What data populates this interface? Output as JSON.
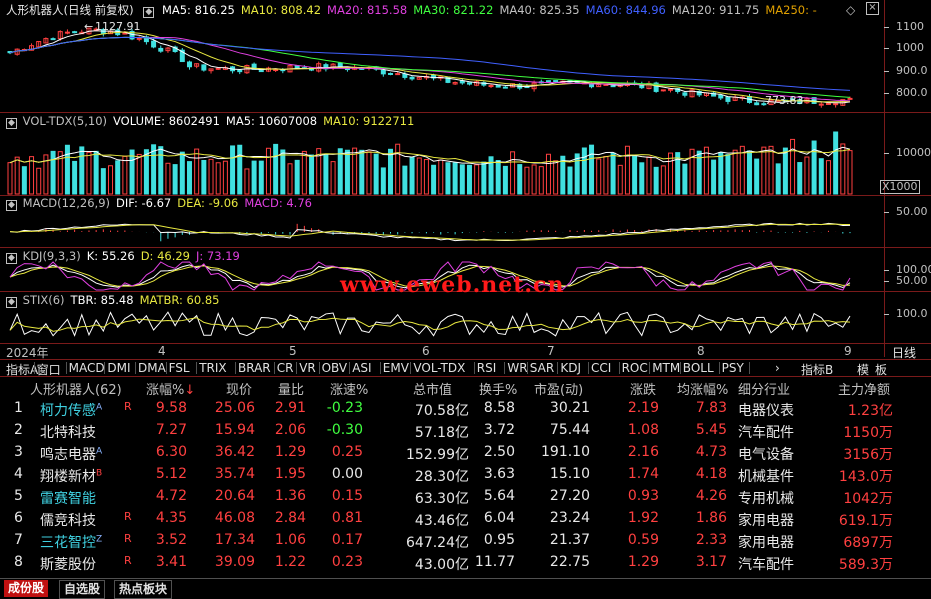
{
  "window": {
    "title": "人形机器人(日线 前复权)"
  },
  "main_pane": {
    "title": "人形机器人(日线 前复权)",
    "ma_labels": [
      {
        "text": "MA5: 816.25",
        "color": "#ffffff"
      },
      {
        "text": "MA10: 808.42",
        "color": "#e8e840"
      },
      {
        "text": "MA20: 815.58",
        "color": "#e040e0"
      },
      {
        "text": "MA30: 821.22",
        "color": "#40ff40"
      },
      {
        "text": "MA40: 825.35",
        "color": "#c0c0c0"
      },
      {
        "text": "MA60: 844.96",
        "color": "#4060ff"
      },
      {
        "text": "MA120: 911.75",
        "color": "#c0c0c0"
      },
      {
        "text": "MA250: -",
        "color": "#e0a000"
      }
    ],
    "high_mark": "1127.91",
    "low_mark": "773.83",
    "y_ticks": [
      "1100",
      "1000",
      "900.0",
      "800.0"
    ]
  },
  "vol_pane": {
    "labels": [
      {
        "text": "VOL-TDX(5,10)",
        "color": "#c0c0c0"
      },
      {
        "text": "VOLUME: 8602491",
        "color": "#ffffff"
      },
      {
        "text": "MA5: 10607008",
        "color": "#ffffff"
      },
      {
        "text": "MA10: 9122711",
        "color": "#e8e840"
      }
    ],
    "y_ticks": [
      "10000"
    ],
    "unit": "X1000"
  },
  "macd_pane": {
    "labels": [
      {
        "text": "MACD(12,26,9)",
        "color": "#c0c0c0"
      },
      {
        "text": "DIF: -6.67",
        "color": "#ffffff"
      },
      {
        "text": "DEA: -9.06",
        "color": "#e8e840"
      },
      {
        "text": "MACD: 4.76",
        "color": "#e040e0"
      }
    ],
    "y_ticks": [
      "50.00"
    ]
  },
  "kdj_pane": {
    "labels": [
      {
        "text": "KDJ(9,3,3)",
        "color": "#c0c0c0"
      },
      {
        "text": "K: 55.26",
        "color": "#ffffff"
      },
      {
        "text": "D: 46.29",
        "color": "#e8e840"
      },
      {
        "text": "J: 73.19",
        "color": "#e040e0"
      }
    ],
    "y_ticks": [
      "100.00",
      "50.00"
    ]
  },
  "stix_pane": {
    "labels": [
      {
        "text": "STIX(6)",
        "color": "#c0c0c0"
      },
      {
        "text": "TBR: 85.48",
        "color": "#ffffff"
      },
      {
        "text": "MATBR: 60.85",
        "color": "#e8e840"
      }
    ],
    "y_ticks": [
      "100.0"
    ]
  },
  "time_axis": {
    "year": "2024年",
    "months": [
      "4",
      "5",
      "6",
      "7",
      "8",
      "9"
    ],
    "period": "日线"
  },
  "watermark": "www.eweb.net.cn",
  "indicator_tabs": [
    "指标A",
    "窗口",
    "MACD",
    "DMI",
    "DMA",
    "FSL",
    "TRIX",
    "BRAR",
    "CR",
    "VR",
    "OBV",
    "ASI",
    "EMV",
    "VOL-TDX",
    "RSI",
    "WR",
    "SAR",
    "KDJ",
    "CCI",
    "ROC",
    "MTM",
    "BOLL",
    "PSY"
  ],
  "indicator_right": [
    "指标B",
    "模",
    "板"
  ],
  "table": {
    "headers": [
      "人形机器人(62)",
      "涨幅%",
      "现价",
      "量比",
      "涨速%",
      "总市值",
      "换手%",
      "市盈(动)",
      "涨跌",
      "均涨幅%",
      "细分行业",
      "主力净额"
    ],
    "rows": [
      {
        "idx": "1",
        "name": "柯力传感",
        "sup": "A",
        "flag": "R",
        "chg": "9.58",
        "price": "25.06",
        "vr": "2.91",
        "speed": "-0.23",
        "mcap": "70.58亿",
        "turn": "8.58",
        "pe": "30.21",
        "diff": "2.19",
        "avg": "7.83",
        "ind": "电器仪表",
        "net": "1.23亿",
        "name_color": "cyan",
        "speed_color": "green"
      },
      {
        "idx": "2",
        "name": "北特科技",
        "sup": "",
        "flag": "",
        "chg": "7.27",
        "price": "15.94",
        "vr": "2.06",
        "speed": "-0.30",
        "mcap": "57.18亿",
        "turn": "3.72",
        "pe": "75.44",
        "diff": "1.08",
        "avg": "5.45",
        "ind": "汽车配件",
        "net": "1150万",
        "name_color": "white",
        "speed_color": "green"
      },
      {
        "idx": "3",
        "name": "鸣志电器",
        "sup": "A",
        "flag": "",
        "chg": "6.30",
        "price": "36.42",
        "vr": "1.29",
        "speed": "0.25",
        "mcap": "152.99亿",
        "turn": "2.50",
        "pe": "191.10",
        "diff": "2.16",
        "avg": "4.73",
        "ind": "电气设备",
        "net": "3156万",
        "name_color": "white",
        "speed_color": "red"
      },
      {
        "idx": "4",
        "name": "翔楼新材",
        "sup": "B",
        "flag": "",
        "chg": "5.12",
        "price": "35.74",
        "vr": "1.95",
        "speed": "0.00",
        "mcap": "28.30亿",
        "turn": "3.63",
        "pe": "15.10",
        "diff": "1.74",
        "avg": "4.18",
        "ind": "机械基件",
        "net": "143.0万",
        "name_color": "white",
        "speed_color": "white"
      },
      {
        "idx": "5",
        "name": "雷赛智能",
        "sup": "",
        "flag": "",
        "chg": "4.72",
        "price": "20.64",
        "vr": "1.36",
        "speed": "0.15",
        "mcap": "63.30亿",
        "turn": "5.64",
        "pe": "27.20",
        "diff": "0.93",
        "avg": "4.26",
        "ind": "专用机械",
        "net": "1042万",
        "name_color": "cyan",
        "speed_color": "red"
      },
      {
        "idx": "6",
        "name": "儒竞科技",
        "sup": "",
        "flag": "R",
        "chg": "4.35",
        "price": "46.08",
        "vr": "2.84",
        "speed": "0.81",
        "mcap": "43.46亿",
        "turn": "6.04",
        "pe": "23.24",
        "diff": "1.92",
        "avg": "1.86",
        "ind": "家用电器",
        "net": "619.1万",
        "name_color": "white",
        "speed_color": "red"
      },
      {
        "idx": "7",
        "name": "三花智控",
        "sup": "Z",
        "flag": "R",
        "chg": "3.52",
        "price": "17.34",
        "vr": "1.06",
        "speed": "0.17",
        "mcap": "647.24亿",
        "turn": "0.95",
        "pe": "21.37",
        "diff": "0.59",
        "avg": "2.33",
        "ind": "家用电器",
        "net": "6897万",
        "name_color": "cyan",
        "speed_color": "red"
      },
      {
        "idx": "8",
        "name": "斯菱股份",
        "sup": "",
        "flag": "R",
        "chg": "3.41",
        "price": "39.09",
        "vr": "1.22",
        "speed": "0.23",
        "mcap": "43.00亿",
        "turn": "11.77",
        "pe": "22.75",
        "diff": "1.29",
        "avg": "3.17",
        "ind": "汽车配件",
        "net": "589.3万",
        "name_color": "white",
        "speed_color": "red"
      }
    ]
  },
  "bottom_tabs": [
    {
      "label": "成份股",
      "active": true
    },
    {
      "label": "自选股",
      "active": false
    },
    {
      "label": "热点板块",
      "active": false
    }
  ],
  "colors": {
    "up": "#ff4040",
    "down": "#40e0e0",
    "grid": "#7a1a1a"
  }
}
